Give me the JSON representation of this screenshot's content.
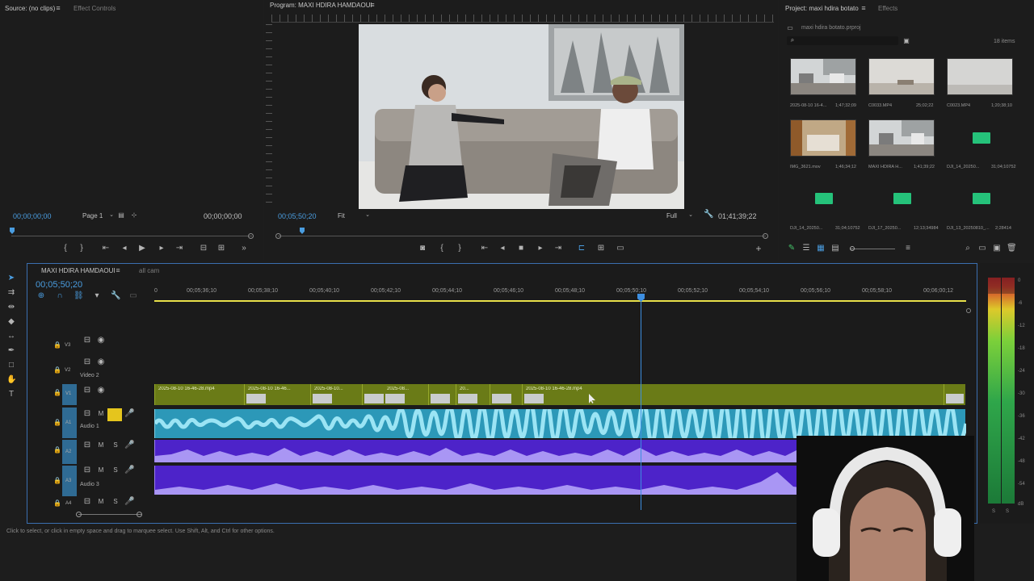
{
  "source_panel": {
    "tab_source": "Source: (no clips)",
    "tab_effect_controls": "Effect Controls",
    "timecode_left": "00;00;00;00",
    "page": "Page 1",
    "timecode_right": "00;00;00;00"
  },
  "program_panel": {
    "tab": "Program: MAXI HDIRA HAMDAOUI",
    "timecode": "00;05;50;20",
    "fit": "Fit",
    "quality": "Full",
    "duration": "01;41;39;22"
  },
  "project_panel": {
    "tab_project": "Project: maxi hdira botato",
    "tab_effects": "Effects",
    "file_name": "maxi hdira botato.prproj",
    "item_count": "18 items",
    "items": [
      {
        "name": "2025-08-10 16-4...",
        "duration": "1;47;32;09",
        "kind": "video"
      },
      {
        "name": "C0033.MP4",
        "duration": "25;02;22",
        "kind": "video"
      },
      {
        "name": "C0023.MP4",
        "duration": "1;20;38;10",
        "kind": "video"
      },
      {
        "name": "IMG_3621.mov",
        "duration": "1;46;34;12",
        "kind": "video"
      },
      {
        "name": "MAXI HDIRA H...",
        "duration": "1;41;39;22",
        "kind": "sequence"
      },
      {
        "name": "DJI_14_20250...",
        "duration": "31;04;10752",
        "kind": "audio"
      },
      {
        "name": "DJI_14_20250...",
        "duration": "31;04;10752",
        "kind": "audio"
      },
      {
        "name": "DJI_17_20250...",
        "duration": "12;13;34984",
        "kind": "audio"
      },
      {
        "name": "DJI_13_20250810_...",
        "duration": "2;28414",
        "kind": "audio"
      }
    ]
  },
  "timeline": {
    "tab_sequence": "MAXI HDIRA HAMDAOUI",
    "tab_all_cam": "all cam",
    "timecode": "00;05;50;20",
    "ruler": [
      "0",
      "00;05;36;10",
      "00;05;38;10",
      "00;05;40;10",
      "00;05;42;10",
      "00;05;44;10",
      "00;05;46;10",
      "00;05;48;10",
      "00;05;50;10",
      "00;05;52;10",
      "00;05;54;10",
      "00;05;56;10",
      "00;05;58;10",
      "00;06;00;12"
    ],
    "tracks": {
      "v3": "V3",
      "v2": "V2",
      "v2_name": "Video 2",
      "v1": "V1",
      "a1": "A1",
      "a1_name": "Audio 1",
      "a2": "A2",
      "a3": "A3",
      "a3_name": "Audio 3",
      "a4": "A4"
    },
    "video_clips": [
      "2025-08-10 16-46-28.mp4",
      "2025-08-10 16-46...",
      "2025-08-10...",
      "2025-08...",
      "20...",
      "2025-08-10 16-46-28.mp4"
    ]
  },
  "meter_labels": [
    "0",
    "-6",
    "-12",
    "-18",
    "-24",
    "-30",
    "-36",
    "-42",
    "-48",
    "-54",
    "dB"
  ],
  "meter_solo": [
    "S",
    "S"
  ],
  "status_bar": "Click to select, or click in empty space and drag to marquee select. Use Shift, Alt, and Ctrl for other options.",
  "colors": {
    "accent": "#4a9de0",
    "video_clip": "#6a7b17",
    "audio1_clip": "#2c98b8",
    "audio_clip": "#4d23c9",
    "playhead": "#3d8ee0"
  }
}
